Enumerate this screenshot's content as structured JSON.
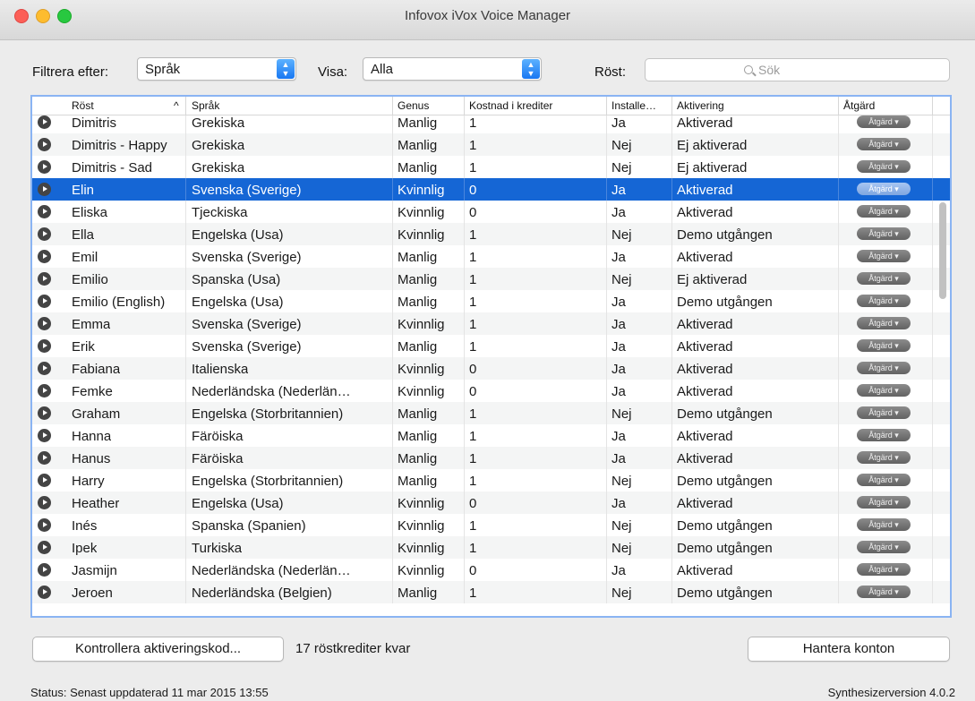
{
  "window": {
    "title": "Infovox iVox Voice Manager"
  },
  "toolbar": {
    "filter_label": "Filtrera efter:",
    "filter_value": "Språk",
    "show_label": "Visa:",
    "show_value": "Alla",
    "voice_label": "Röst:",
    "search_placeholder": "Sök"
  },
  "table": {
    "columns": [
      "Röst",
      "Språk",
      "Genus",
      "Kostnad i krediter",
      "Installe…",
      "Aktivering",
      "Åtgärd"
    ],
    "action_label": "Åtgärd ▾",
    "selected_index": 3,
    "rows": [
      [
        "Dimitris",
        "Grekiska",
        "Manlig",
        "1",
        "Ja",
        "Aktiverad"
      ],
      [
        "Dimitris - Happy",
        "Grekiska",
        "Manlig",
        "1",
        "Nej",
        "Ej aktiverad"
      ],
      [
        "Dimitris - Sad",
        "Grekiska",
        "Manlig",
        "1",
        "Nej",
        "Ej aktiverad"
      ],
      [
        "Elin",
        "Svenska (Sverige)",
        "Kvinnlig",
        "0",
        "Ja",
        "Aktiverad"
      ],
      [
        "Eliska",
        "Tjeckiska",
        "Kvinnlig",
        "0",
        "Ja",
        "Aktiverad"
      ],
      [
        "Ella",
        "Engelska (Usa)",
        "Kvinnlig",
        "1",
        "Nej",
        "Demo utgången"
      ],
      [
        "Emil",
        "Svenska (Sverige)",
        "Manlig",
        "1",
        "Ja",
        "Aktiverad"
      ],
      [
        "Emilio",
        "Spanska (Usa)",
        "Manlig",
        "1",
        "Nej",
        "Ej aktiverad"
      ],
      [
        "Emilio (English)",
        "Engelska (Usa)",
        "Manlig",
        "1",
        "Ja",
        "Demo utgången"
      ],
      [
        "Emma",
        "Svenska (Sverige)",
        "Kvinnlig",
        "1",
        "Ja",
        "Aktiverad"
      ],
      [
        "Erik",
        "Svenska (Sverige)",
        "Manlig",
        "1",
        "Ja",
        "Aktiverad"
      ],
      [
        "Fabiana",
        "Italienska",
        "Kvinnlig",
        "0",
        "Ja",
        "Aktiverad"
      ],
      [
        "Femke",
        "Nederländska (Nederlän…",
        "Kvinnlig",
        "0",
        "Ja",
        "Aktiverad"
      ],
      [
        "Graham",
        "Engelska (Storbritannien)",
        "Manlig",
        "1",
        "Nej",
        "Demo utgången"
      ],
      [
        "Hanna",
        "Färöiska",
        "Manlig",
        "1",
        "Ja",
        "Aktiverad"
      ],
      [
        "Hanus",
        "Färöiska",
        "Manlig",
        "1",
        "Ja",
        "Aktiverad"
      ],
      [
        "Harry",
        "Engelska (Storbritannien)",
        "Manlig",
        "1",
        "Nej",
        "Demo utgången"
      ],
      [
        "Heather",
        "Engelska (Usa)",
        "Kvinnlig",
        "0",
        "Ja",
        "Aktiverad"
      ],
      [
        "Inés",
        "Spanska (Spanien)",
        "Kvinnlig",
        "1",
        "Nej",
        "Demo utgången"
      ],
      [
        "Ipek",
        "Turkiska",
        "Kvinnlig",
        "1",
        "Nej",
        "Demo utgången"
      ],
      [
        "Jasmijn",
        "Nederländska (Nederlän…",
        "Kvinnlig",
        "0",
        "Ja",
        "Aktiverad"
      ],
      [
        "Jeroen",
        "Nederländska (Belgien)",
        "Manlig",
        "1",
        "Nej",
        "Demo utgången"
      ]
    ]
  },
  "footer": {
    "check_code_button": "Kontrollera aktiveringskod...",
    "credits_left": "17 röstkrediter kvar",
    "manage_accounts_button": "Hantera konton",
    "status": "Status: Senast uppdaterad 11 mar 2015 13:55",
    "synth_version": "Synthesizerversion 4.0.2"
  },
  "colors": {
    "selection": "#1566d5",
    "focus_ring": "#8ab4f3",
    "accent": "#1877f2"
  }
}
